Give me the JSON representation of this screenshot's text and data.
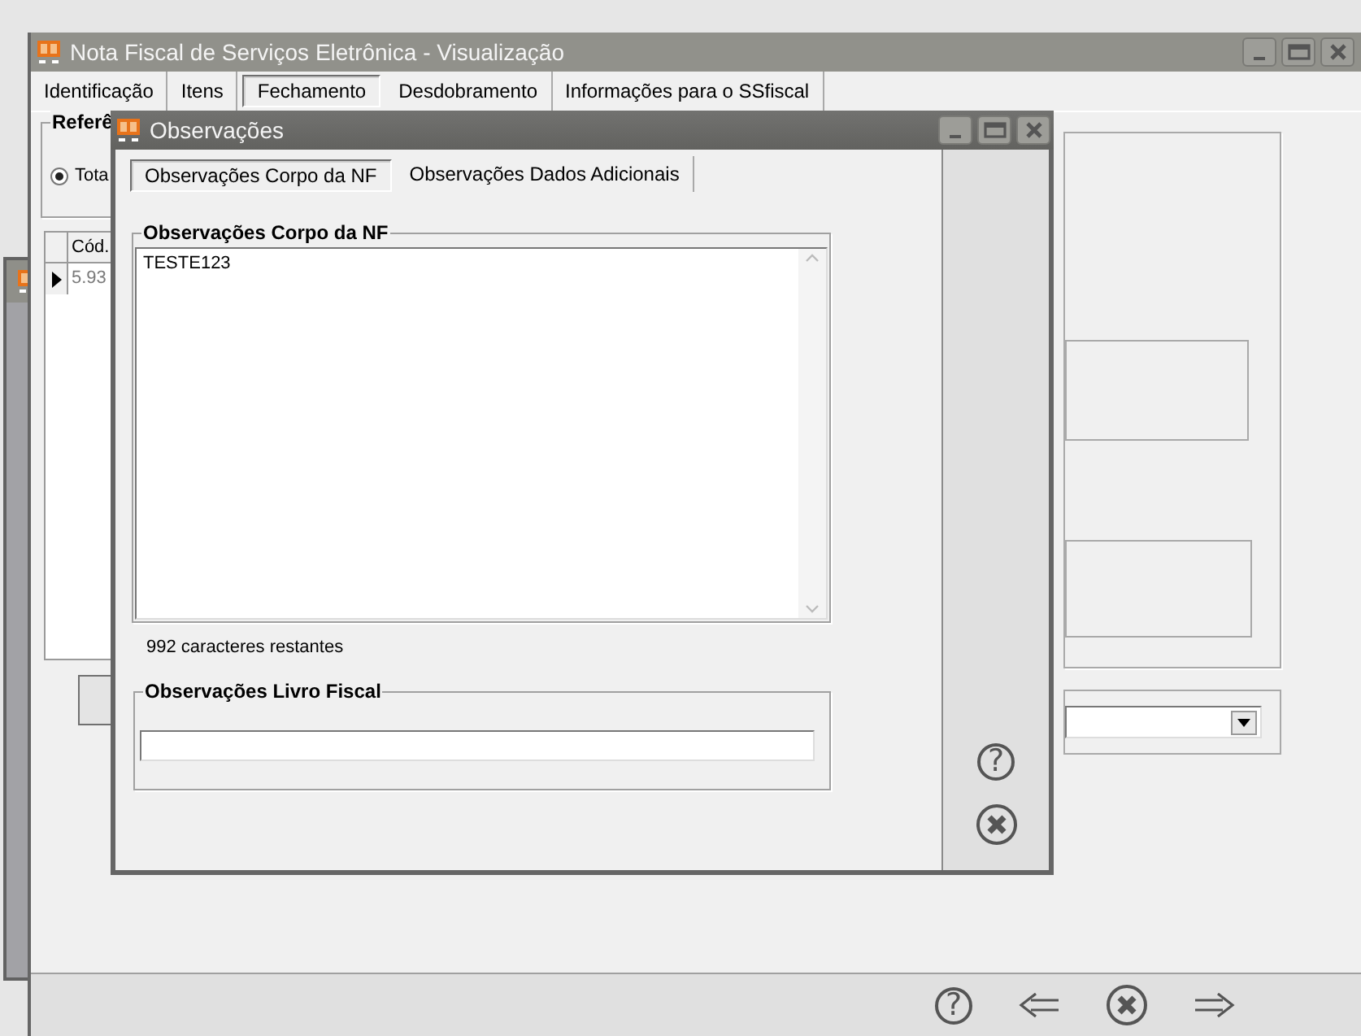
{
  "background_window": {
    "kind": "window"
  },
  "main_window": {
    "title": "Nota Fiscal de Serviços Eletrônica - Visualização",
    "tabs": [
      {
        "label": "Identificação",
        "selected": false
      },
      {
        "label": "Itens",
        "selected": false
      },
      {
        "label": "Fechamento",
        "selected": true
      },
      {
        "label": "Desdobramento",
        "selected": false
      },
      {
        "label": "Informações para o SSfiscal",
        "selected": false
      }
    ],
    "group_title": "Referê",
    "radio": {
      "label": "Tota",
      "checked": true
    },
    "grid": {
      "columns": [
        "Cód."
      ],
      "rows": [
        {
          "cells": [
            "5.93"
          ],
          "current": true
        }
      ]
    },
    "toolbar": [
      {
        "kind": "help",
        "label": "?"
      },
      {
        "kind": "back"
      },
      {
        "kind": "cancel"
      },
      {
        "kind": "forward"
      }
    ]
  },
  "dialog": {
    "title": "Observações",
    "tabs": [
      {
        "label": "Observações Corpo da NF",
        "selected": true
      },
      {
        "label": "Observações Dados Adicionais",
        "selected": false
      }
    ],
    "body_group": {
      "title": "Observações Corpo da NF",
      "value": "TESTE123"
    },
    "remaining": "992 caracteres restantes",
    "fiscal_group": {
      "title": "Observações Livro Fiscal"
    },
    "side_buttons": [
      {
        "kind": "help",
        "label": "?"
      },
      {
        "kind": "cancel"
      }
    ]
  }
}
